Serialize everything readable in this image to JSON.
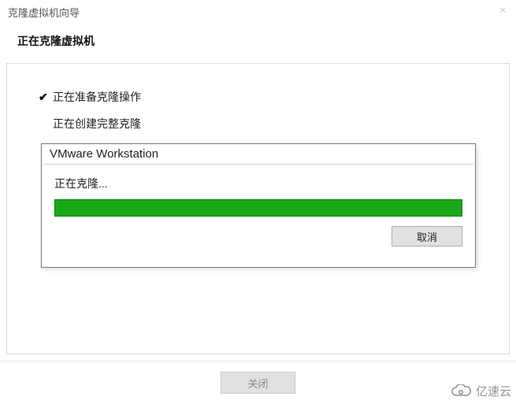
{
  "window": {
    "title": "克隆虚拟机向导",
    "heading": "正在克隆虚拟机"
  },
  "steps": {
    "step1": {
      "label": "正在准备克隆操作",
      "checked": true
    },
    "step2": {
      "label": "正在创建完整克隆",
      "checked": false
    }
  },
  "footer": {
    "close_label": "关闭"
  },
  "modal": {
    "title": "VMware Workstation",
    "status": "正在克隆...",
    "cancel_label": "取消",
    "progress_percent": 100
  },
  "watermark": {
    "text": "亿速云"
  },
  "colors": {
    "progress_fill": "#17a817"
  }
}
